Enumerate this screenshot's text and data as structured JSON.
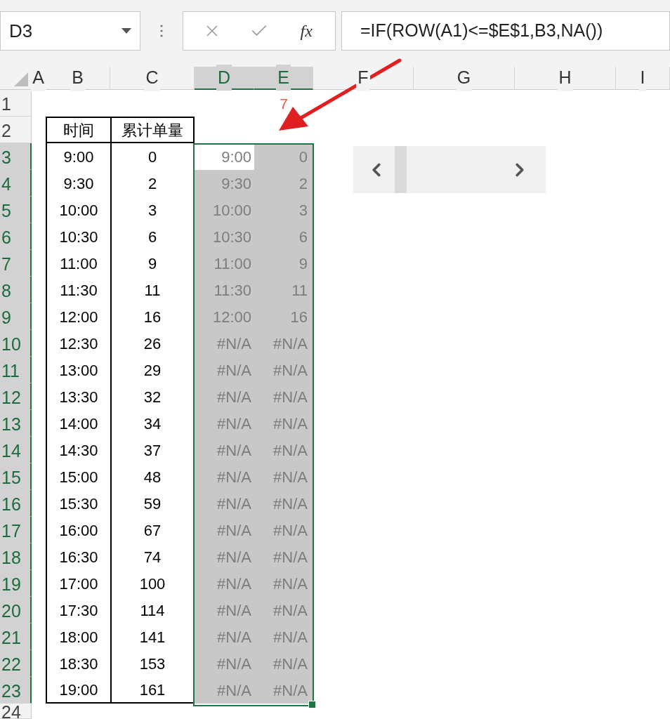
{
  "formula_bar": {
    "name_box": "D3",
    "fx_label": "fx",
    "formula": "=IF(ROW(A1)<=$E$1,B3,NA())"
  },
  "columns": [
    {
      "label": "A",
      "selected": false
    },
    {
      "label": "B",
      "selected": false
    },
    {
      "label": "C",
      "selected": false
    },
    {
      "label": "D",
      "selected": true
    },
    {
      "label": "E",
      "selected": true
    },
    {
      "label": "F",
      "selected": false
    },
    {
      "label": "G",
      "selected": false
    },
    {
      "label": "H",
      "selected": false
    },
    {
      "label": "I",
      "selected": false
    }
  ],
  "top_rows": [
    {
      "number": "1",
      "selected": false,
      "e_value": "7"
    },
    {
      "number": "2",
      "selected": false,
      "headers": [
        "时间",
        "累计单量"
      ]
    }
  ],
  "table_rows": [
    {
      "number": "3",
      "selected": true,
      "active": true,
      "time": "9:00",
      "count": "0",
      "d": "9:00",
      "e": "0"
    },
    {
      "number": "4",
      "selected": true,
      "active": false,
      "time": "9:30",
      "count": "2",
      "d": "9:30",
      "e": "2"
    },
    {
      "number": "5",
      "selected": true,
      "active": false,
      "time": "10:00",
      "count": "3",
      "d": "10:00",
      "e": "3"
    },
    {
      "number": "6",
      "selected": true,
      "active": false,
      "time": "10:30",
      "count": "6",
      "d": "10:30",
      "e": "6"
    },
    {
      "number": "7",
      "selected": true,
      "active": false,
      "time": "11:00",
      "count": "9",
      "d": "11:00",
      "e": "9"
    },
    {
      "number": "8",
      "selected": true,
      "active": false,
      "time": "11:30",
      "count": "11",
      "d": "11:30",
      "e": "11"
    },
    {
      "number": "9",
      "selected": true,
      "active": false,
      "time": "12:00",
      "count": "16",
      "d": "12:00",
      "e": "16"
    },
    {
      "number": "10",
      "selected": true,
      "active": false,
      "time": "12:30",
      "count": "26",
      "d": "#N/A",
      "e": "#N/A"
    },
    {
      "number": "11",
      "selected": true,
      "active": false,
      "time": "13:00",
      "count": "29",
      "d": "#N/A",
      "e": "#N/A"
    },
    {
      "number": "12",
      "selected": true,
      "active": false,
      "time": "13:30",
      "count": "32",
      "d": "#N/A",
      "e": "#N/A"
    },
    {
      "number": "13",
      "selected": true,
      "active": false,
      "time": "14:00",
      "count": "34",
      "d": "#N/A",
      "e": "#N/A"
    },
    {
      "number": "14",
      "selected": true,
      "active": false,
      "time": "14:30",
      "count": "37",
      "d": "#N/A",
      "e": "#N/A"
    },
    {
      "number": "15",
      "selected": true,
      "active": false,
      "time": "15:00",
      "count": "48",
      "d": "#N/A",
      "e": "#N/A"
    },
    {
      "number": "16",
      "selected": true,
      "active": false,
      "time": "15:30",
      "count": "59",
      "d": "#N/A",
      "e": "#N/A"
    },
    {
      "number": "17",
      "selected": true,
      "active": false,
      "time": "16:00",
      "count": "67",
      "d": "#N/A",
      "e": "#N/A"
    },
    {
      "number": "18",
      "selected": true,
      "active": false,
      "time": "16:30",
      "count": "74",
      "d": "#N/A",
      "e": "#N/A"
    },
    {
      "number": "19",
      "selected": true,
      "active": false,
      "time": "17:00",
      "count": "100",
      "d": "#N/A",
      "e": "#N/A"
    },
    {
      "number": "20",
      "selected": true,
      "active": false,
      "time": "17:30",
      "count": "114",
      "d": "#N/A",
      "e": "#N/A"
    },
    {
      "number": "21",
      "selected": true,
      "active": false,
      "time": "18:00",
      "count": "141",
      "d": "#N/A",
      "e": "#N/A"
    },
    {
      "number": "22",
      "selected": true,
      "active": false,
      "time": "18:30",
      "count": "153",
      "d": "#N/A",
      "e": "#N/A"
    },
    {
      "number": "23",
      "selected": true,
      "active": false,
      "time": "19:00",
      "count": "161",
      "d": "#N/A",
      "e": "#N/A"
    }
  ],
  "bottom_row": {
    "number": "24",
    "selected": false
  }
}
